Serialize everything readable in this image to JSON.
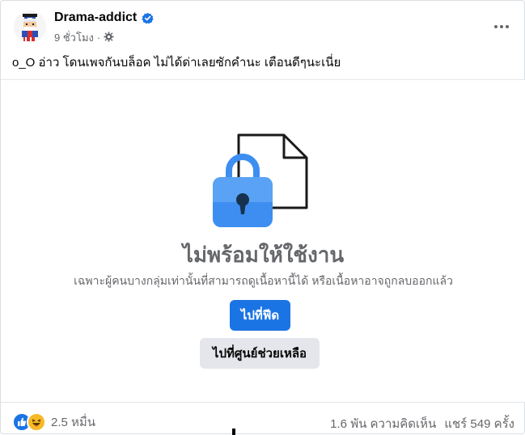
{
  "post": {
    "author": "Drama-addict",
    "time": "9 ชั่วโมง",
    "separator": "·",
    "text": "o_O อ่าว โดนเพจกันบล็อค ไม่ได้ด่าเลยซักคำนะ เตือนดีๆนะเนี่ย"
  },
  "content_unavailable": {
    "title": "ไม่พร้อมให้ใช้งาน",
    "subtitle": "เฉพาะผู้คนบางกลุ่มเท่านั้นที่สามารถดูเนื้อหานี้ได้ หรือเนื้อหาอาจถูกลบออกแล้ว",
    "go_to_feed": "ไปที่ฟีด",
    "help_center": "ไปที่ศูนย์ช่วยเหลือ"
  },
  "footer": {
    "reaction_count": "2.5 หมื่น",
    "comments": "1.6 พัน ความคิดเห็น",
    "shares": "แชร์ 549 ครั้ง"
  },
  "icons": {
    "more": "more-options-icon",
    "privacy": "gear-icon",
    "verified": "verified-badge-icon",
    "like": "like-reaction-icon",
    "haha": "haha-reaction-icon"
  },
  "colors": {
    "accent": "#1b74e4",
    "secondary_text": "#65676b",
    "button_gray": "#e4e6eb",
    "lock_blue": "#3d8ef0"
  }
}
